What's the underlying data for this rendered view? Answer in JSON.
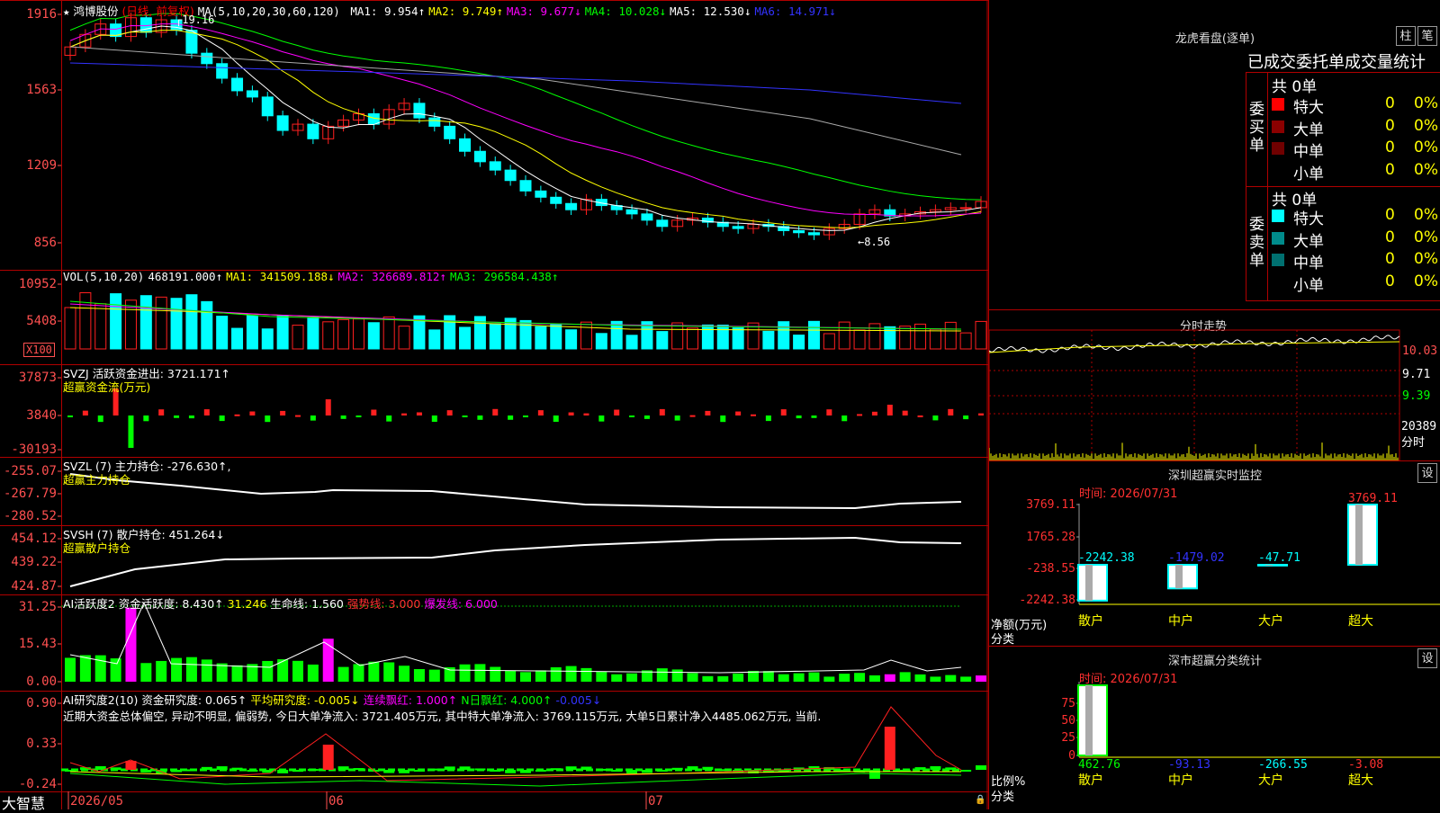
{
  "app_name": "大智慧",
  "main": {
    "stock_name": "鸿博股份",
    "period_label": "(日线, 前复权)",
    "ma_header": "MA(5,10,20,30,60,120)",
    "ma_values": [
      {
        "label": "MA1: 9.954↑",
        "color": "#ffffff"
      },
      {
        "label": "MA2: 9.749↑",
        "color": "#ffff00"
      },
      {
        "label": "MA3: 9.677↓",
        "color": "#ff00ff"
      },
      {
        "label": "MA4: 10.028↓",
        "color": "#00ff00"
      },
      {
        "label": "MA5: 12.530↓",
        "color": "#ffffff"
      },
      {
        "label": "MA6: 14.971↓",
        "color": "#3333ff"
      }
    ],
    "high_label": "19.16",
    "low_label": "←8.56",
    "y_ticks": [
      "1916",
      "1563",
      "1209",
      "856"
    ]
  },
  "volume": {
    "header": "VOL(5,10,20)",
    "value": "468191.000↑",
    "ma1": "MA1: 341509.188↓",
    "ma2": "MA2: 326689.812↑",
    "ma3": "MA3: 296584.438↑",
    "y_ticks": [
      "10952",
      "5408"
    ],
    "unit": "X100"
  },
  "svzj": {
    "header": "SVZJ 活跃资金进出: 3721.171↑",
    "subtitle": "超赢资金流(万元)",
    "y_ticks": [
      "37873",
      "3840",
      "-30193"
    ]
  },
  "svzl": {
    "header": "SVZL (7) 主力持仓: -276.630↑,",
    "subtitle": "超赢主力持仓",
    "y_ticks": [
      "-255.07",
      "-267.79",
      "-280.52"
    ]
  },
  "svsh": {
    "header": "SVSH (7) 散户持仓: 451.264↓",
    "subtitle": "超赢散户持仓",
    "y_ticks": [
      "454.12",
      "439.22",
      "424.87"
    ]
  },
  "ai_active": {
    "header": "AI活跃度2",
    "v1": "资金活跃度: 8.430↑",
    "v2": "31.246",
    "v3": "生命线: 1.560",
    "v4": "强势线: 3.000",
    "v5": "爆发线: 6.000",
    "y_ticks": [
      "31.25",
      "15.43",
      "0.00"
    ]
  },
  "ai_research": {
    "header": "AI研究度2(10)",
    "v1": "资金研究度: 0.065↑",
    "v2": "平均研究度: -0.005↓",
    "v3": "连续飘红: 1.000↑",
    "v4": "N日飘红: 4.000↑",
    "v5": "-0.005↓",
    "summary": "近期大资金总体偏空, 异动不明显, 偏弱势, 今日大单净流入: 3721.405万元, 其中特大单净流入: 3769.115万元, 大单5日累计净入4485.062万元, 当前.",
    "y_ticks": [
      "0.90",
      "0.33",
      "-0.24"
    ]
  },
  "x_axis": {
    "labels": [
      "2026/05",
      "06",
      "07"
    ]
  },
  "dragon": {
    "title": "龙虎看盘(逐单)",
    "btn1": "柱",
    "btn2": "笔",
    "header": "已成交委托单成交量统计",
    "buy_side": "委买单",
    "sell_side": "委卖单",
    "buy_total": "共 0单",
    "sell_total": "共 0单",
    "buy_rows": [
      {
        "label": "特大",
        "count": "0",
        "pct": "0%",
        "color": "#ff0000"
      },
      {
        "label": "大单",
        "count": "0",
        "pct": "0%",
        "color": "#8b0000"
      },
      {
        "label": "中单",
        "count": "0",
        "pct": "0%",
        "color": "#700000"
      },
      {
        "label": "小单",
        "count": "0",
        "pct": "0%",
        "color": ""
      }
    ],
    "sell_rows": [
      {
        "label": "特大",
        "count": "0",
        "pct": "0%",
        "color": "#00ffff"
      },
      {
        "label": "大单",
        "count": "0",
        "pct": "0%",
        "color": "#008b8b"
      },
      {
        "label": "中单",
        "count": "0",
        "pct": "0%",
        "color": "#007070"
      },
      {
        "label": "小单",
        "count": "0",
        "pct": "0%",
        "color": ""
      }
    ]
  },
  "intraday": {
    "title": "分时走势",
    "prices": [
      "10.03",
      "9.71",
      "9.39"
    ],
    "volume_label": "20389",
    "tab": "分时"
  },
  "sz_monitor": {
    "title": "深圳超赢实时监控",
    "btn": "设",
    "time": "时间: 2026/07/31",
    "y_ticks": [
      "3769.11",
      "1765.28",
      "-238.55",
      "-2242.38"
    ],
    "y_axis_label": "净额(万元)",
    "x_axis_label": "分类",
    "bars": [
      {
        "category": "散户",
        "value": -2242.38,
        "label": "-2242.38"
      },
      {
        "category": "中户",
        "value": -1479.02,
        "label": "-1479.02"
      },
      {
        "category": "大户",
        "value": -47.71,
        "label": "-47.71"
      },
      {
        "category": "超大",
        "value": 3769.11,
        "label": "3769.11"
      }
    ]
  },
  "sz_class": {
    "title": "深市超赢分类统计",
    "btn": "设",
    "time": "时间: 2026/07/31",
    "y_ticks": [
      "75",
      "50",
      "25",
      "0"
    ],
    "y_axis_label": "比例%",
    "x_axis_label": "分类",
    "bars": [
      {
        "category": "散户",
        "value": 100,
        "label": "462.76"
      },
      {
        "category": "中户",
        "value": 0,
        "label": "-93.13"
      },
      {
        "category": "大户",
        "value": 0,
        "label": "-266.55"
      },
      {
        "category": "超大",
        "value": 0,
        "label": "-3.08"
      }
    ]
  },
  "colors": {
    "up": "#ff2020",
    "down": "#00ffff",
    "grid": "#b00000",
    "tick": "#ff5050",
    "green": "#00ff00",
    "magenta": "#ff00ff",
    "yellow": "#ffff00"
  }
}
